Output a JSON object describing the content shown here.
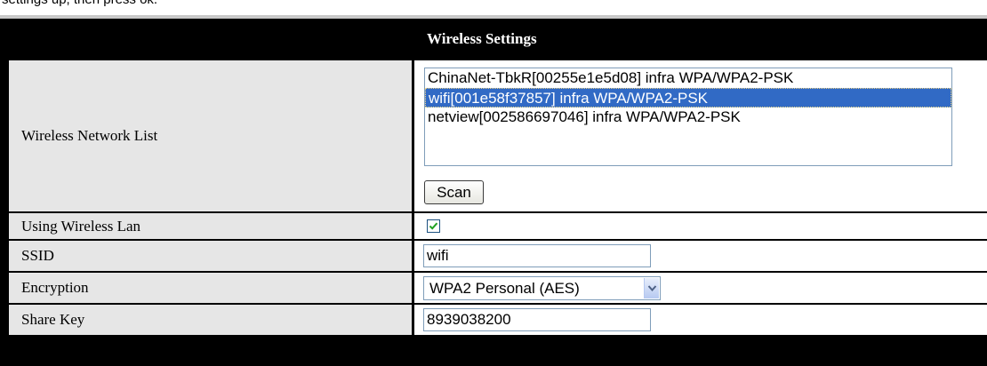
{
  "page": {
    "top_cut_text": "settings up, then press ok.",
    "section_title": "Wireless Settings"
  },
  "network_list": {
    "label": "Wireless Network List",
    "items": [
      {
        "text": "ChinaNet-TbkR[00255e1e5d08] infra WPA/WPA2-PSK",
        "selected": false
      },
      {
        "text": "wifi[001e58f37857] infra WPA/WPA2-PSK",
        "selected": true
      },
      {
        "text": "netview[002586697046] infra WPA/WPA2-PSK",
        "selected": false
      }
    ],
    "scan_label": "Scan"
  },
  "using_wlan": {
    "label": "Using Wireless Lan",
    "checked": true
  },
  "ssid": {
    "label": "SSID",
    "value": "wifi"
  },
  "encryption": {
    "label": "Encryption",
    "value": "WPA2 Personal (AES)"
  },
  "share_key": {
    "label": "Share Key",
    "value": "8939038200"
  },
  "colors": {
    "header_bg": "#000000",
    "label_bg": "#e6e6e6",
    "selection": "#316ac5",
    "input_border": "#7f9db9"
  },
  "icons": {
    "checkbox": "checkmark-icon",
    "dropdown": "chevron-down-icon"
  }
}
